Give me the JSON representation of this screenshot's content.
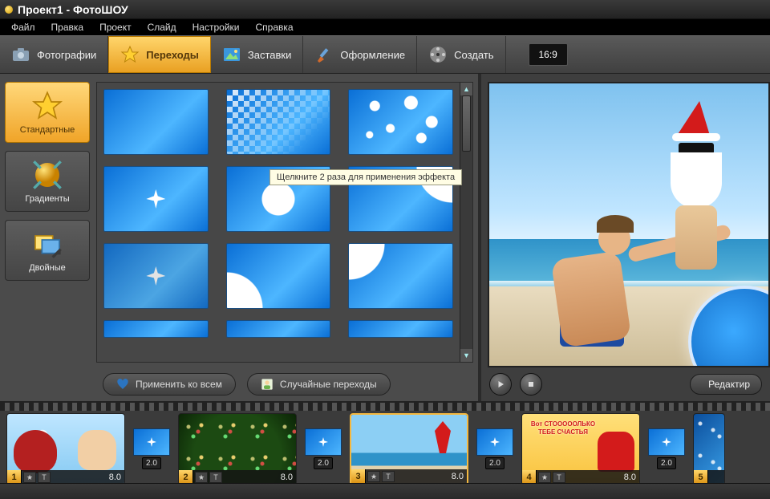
{
  "window": {
    "title": "Проект1 - ФотоШОУ"
  },
  "menu": {
    "file": "Файл",
    "edit": "Правка",
    "project": "Проект",
    "slide": "Слайд",
    "settings": "Настройки",
    "help": "Справка"
  },
  "tabs": {
    "photos": "Фотографии",
    "transitions": "Переходы",
    "titles": "Заставки",
    "design": "Оформление",
    "create": "Создать"
  },
  "aspect": {
    "label": "16:9"
  },
  "categories": {
    "standard": "Стандартные",
    "gradients": "Градиенты",
    "double": "Двойные"
  },
  "tooltip": {
    "text": "Щелкните 2 раза для применения эффекта"
  },
  "left_buttons": {
    "apply_all": "Применить ко всем",
    "random": "Случайные переходы"
  },
  "preview": {
    "edit": "Редактир"
  },
  "timeline": {
    "slides": [
      {
        "num": "1",
        "duration": "8.0"
      },
      {
        "num": "2",
        "duration": "8.0"
      },
      {
        "num": "3",
        "duration": "8.0"
      },
      {
        "num": "4",
        "duration": "8.0"
      },
      {
        "num": "5",
        "duration": ""
      }
    ],
    "transitions": [
      {
        "duration": "2.0"
      },
      {
        "duration": "2.0"
      },
      {
        "duration": "2.0"
      },
      {
        "duration": "2.0"
      }
    ],
    "slide4_text": "Вот СТОООООЛЬКО ТЕБЕ СЧАСТЬЯ"
  },
  "icons": {
    "star": "★",
    "text": "T"
  }
}
